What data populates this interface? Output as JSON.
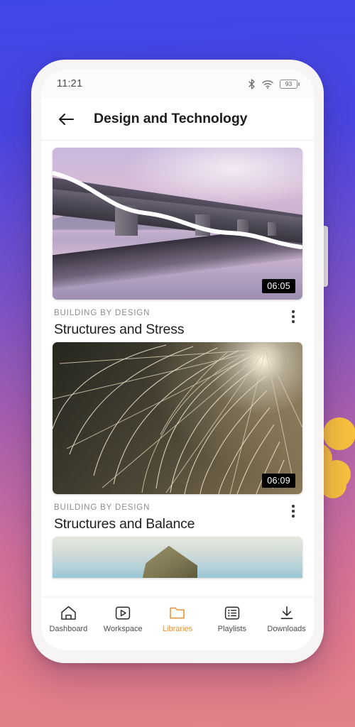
{
  "background": {
    "gradient_from": "#4147e6",
    "gradient_to": "#e08287",
    "accent_dot_color": "#fbc23e"
  },
  "device": {
    "frame_color": "#f6f5f4",
    "side_button": "power-button"
  },
  "status_bar": {
    "time": "11:21",
    "bluetooth_icon": "bluetooth-icon",
    "wifi_icon": "wifi-icon",
    "battery_level": "93"
  },
  "app_bar": {
    "back_icon": "back-arrow-icon",
    "title": "Design and Technology"
  },
  "cards": [
    {
      "eyebrow": "BUILDING BY DESIGN",
      "title": "Structures and Stress",
      "duration": "06:05",
      "artwork": "bridge-over-water-at-dusk",
      "menu_icon": "more-vertical-icon"
    },
    {
      "eyebrow": "BUILDING BY DESIGN",
      "title": "Structures and Balance",
      "duration": "06:09",
      "artwork": "spider-web-backlit",
      "menu_icon": "more-vertical-icon"
    },
    {
      "artwork": "cliff-rock-and-sky"
    }
  ],
  "bottom_nav": {
    "active_color": "#e8943e",
    "items": [
      {
        "label": "Dashboard",
        "icon": "home-icon",
        "active": false
      },
      {
        "label": "Workspace",
        "icon": "play-box-icon",
        "active": false
      },
      {
        "label": "Libraries",
        "icon": "folder-icon",
        "active": true
      },
      {
        "label": "Playlists",
        "icon": "list-icon",
        "active": false
      },
      {
        "label": "Downloads",
        "icon": "download-icon",
        "active": false
      }
    ]
  }
}
